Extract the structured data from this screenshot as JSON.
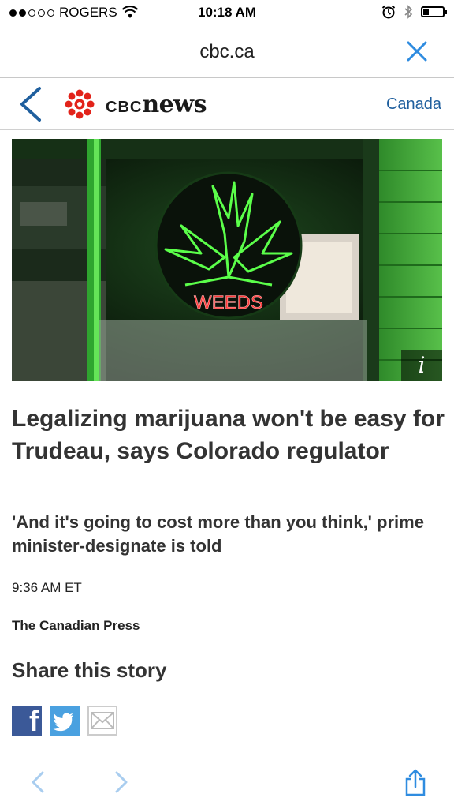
{
  "status_bar": {
    "carrier": "ROGERS",
    "time": "10:18 AM",
    "signal_bars_filled": 2,
    "signal_bars_total": 5
  },
  "browser": {
    "url": "cbc.ca",
    "close_icon": "close-x-icon"
  },
  "site_header": {
    "back_icon": "chevron-left-icon",
    "logo_text_a": "CBC",
    "logo_text_b": "news",
    "section": "Canada"
  },
  "article": {
    "image_info_label": "i",
    "sign_text": "WEEDS",
    "headline": "Legalizing marijuana won't be easy for Trudeau, says Colorado regulator",
    "deck": "'And it's going to cost more than you think,' prime minister-designate is told",
    "published": "9:36 AM ET",
    "source": "The Canadian Press"
  },
  "share": {
    "title": "Share this story",
    "facebook_glyph": "f",
    "icons": [
      "facebook-icon",
      "twitter-icon",
      "email-icon"
    ]
  },
  "toolbar": {
    "icons": [
      "back-arrow-icon",
      "forward-arrow-icon",
      "share-icon"
    ]
  },
  "colors": {
    "link_blue": "#1f5f9e",
    "cbc_red": "#e2231a",
    "facebook": "#3b5998",
    "twitter": "#4aa1e0",
    "ios_blue": "#2f8ce0"
  }
}
